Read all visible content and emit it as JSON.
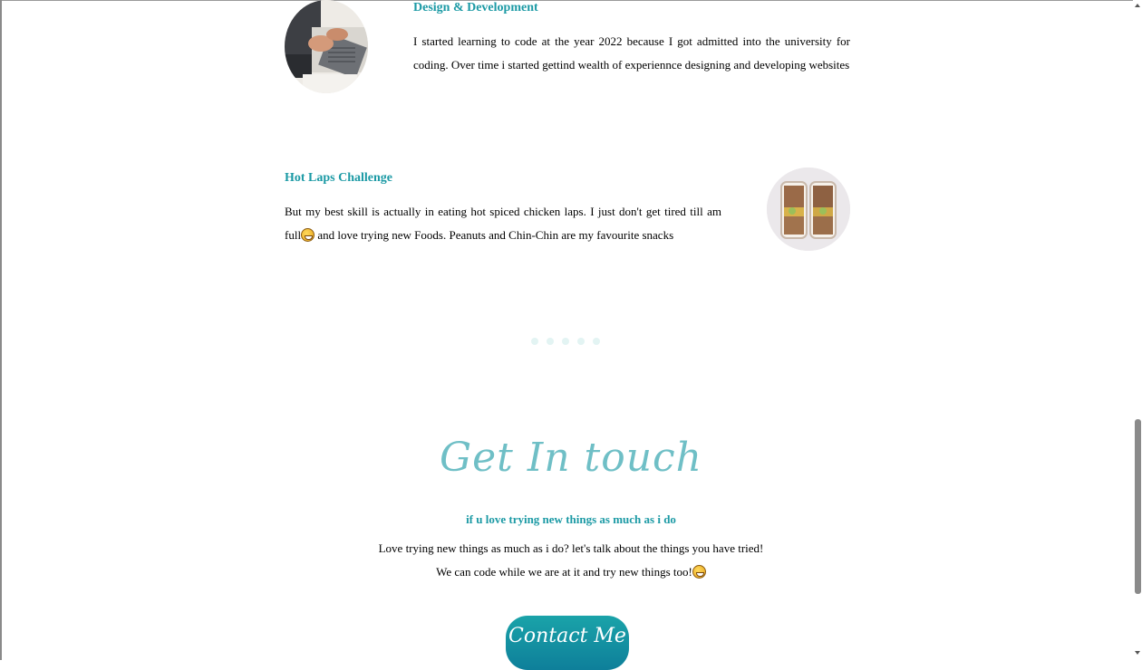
{
  "sections": [
    {
      "title": "Design & Development",
      "text": "I started learning to code at the year 2022 because I got admitted into the university for coding. Over time i started gettind wealth of experiennce designing and developing websites",
      "image": "laptop-typing-photo"
    },
    {
      "title": "Hot Laps Challenge",
      "text_before_emoji": "But my best skill is actually in eating hot spiced chicken laps. I just don't get tired till am full",
      "text_after_emoji": " and love trying new Foods. Peanuts and Chin-Chin are my favourite snacks",
      "image": "food-containers-photo"
    }
  ],
  "carousel_dots": 5,
  "contact": {
    "title": "Get In touch",
    "subtitle": "if u love trying new things as much as i do",
    "line1": "Love trying new things as much as i do? let's talk about the things you have tried!",
    "line2": "We can code while we are at it and try new things too!",
    "button_label": "Contact Me"
  },
  "colors": {
    "accent": "#1c9aa5",
    "heading_script": "#6fbfc6",
    "button_top": "#1aa3a9",
    "button_bottom": "#0e7f9a"
  }
}
